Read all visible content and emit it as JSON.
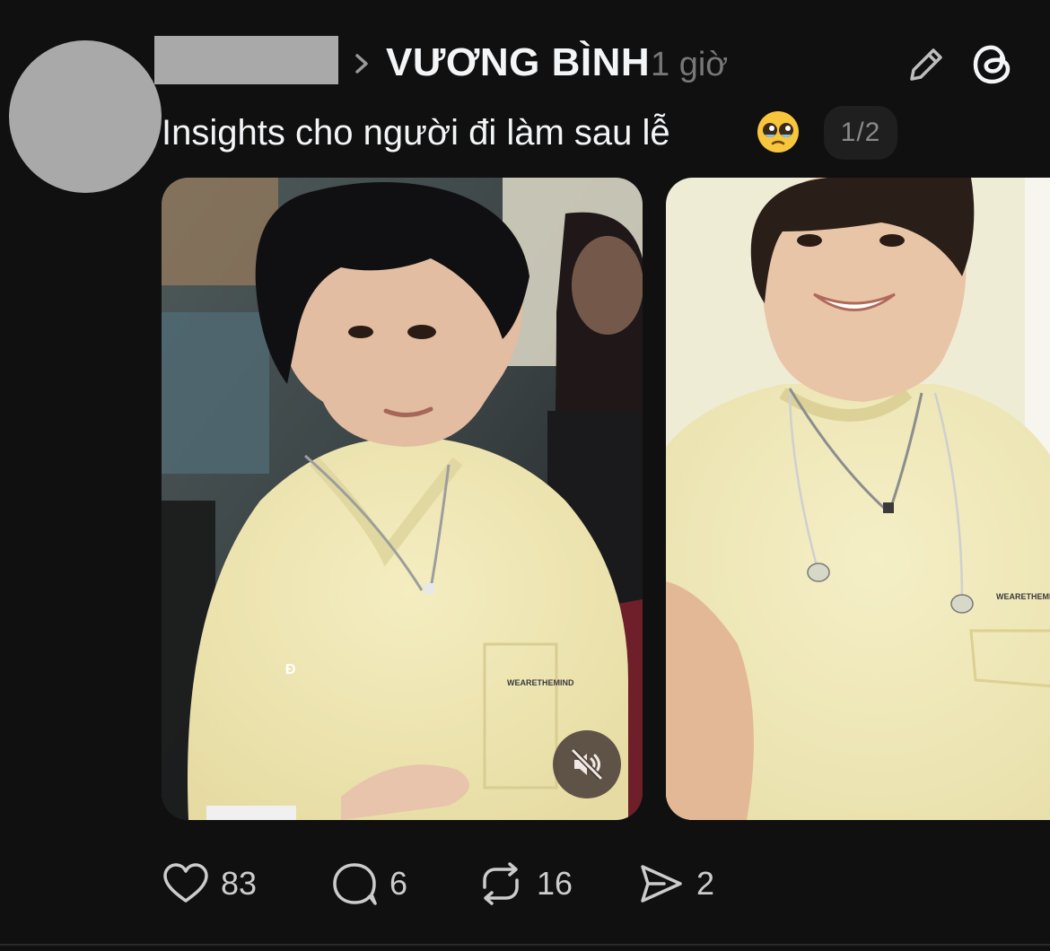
{
  "header": {
    "community": "VƯƠNG BÌNH",
    "time": "1 giờ"
  },
  "post": {
    "caption": "Insights cho người đi làm sau lễ",
    "emoji": "🥹",
    "media_counter": "1/2",
    "watermark": "Đ",
    "shirt_text_1": "WEARETHEMIND",
    "shirt_text_2": "WEARETHEMIND"
  },
  "actions": {
    "likes": "83",
    "replies": "6",
    "reposts": "16",
    "shares": "2"
  },
  "icons": [
    "chevron-right-icon",
    "pencil-icon",
    "threads-logo-icon",
    "muted-speaker-icon",
    "heart-icon",
    "comment-icon",
    "repost-icon",
    "send-icon"
  ],
  "colors": {
    "background": "#101010",
    "text": "#f3f5f7",
    "muted": "#777777",
    "placeholder": "#a9a9a9"
  }
}
